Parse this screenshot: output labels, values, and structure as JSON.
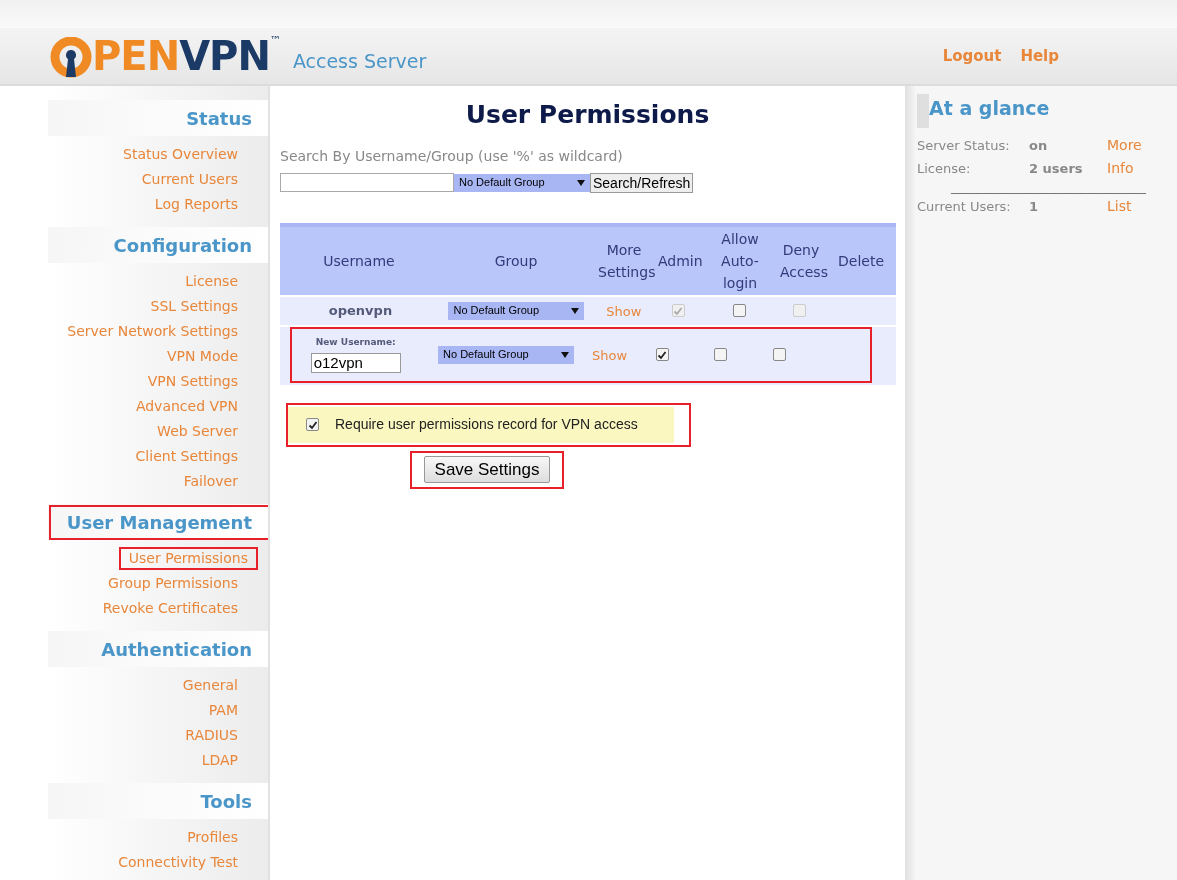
{
  "header": {
    "logo": {
      "prefix": "PEN",
      "suffix": "VPN",
      "mark": "™"
    },
    "subtitle": "Access Server",
    "links": [
      "Logout",
      "Help"
    ]
  },
  "sidebar": [
    {
      "title": "Status",
      "highlighted": false,
      "items": [
        {
          "label": "Status Overview",
          "highlighted": false
        },
        {
          "label": "Current Users",
          "highlighted": false
        },
        {
          "label": "Log Reports",
          "highlighted": false
        }
      ]
    },
    {
      "title": "Configuration",
      "highlighted": false,
      "items": [
        {
          "label": "License",
          "highlighted": false
        },
        {
          "label": "SSL Settings",
          "highlighted": false
        },
        {
          "label": "Server Network Settings",
          "highlighted": false
        },
        {
          "label": "VPN Mode",
          "highlighted": false
        },
        {
          "label": "VPN Settings",
          "highlighted": false
        },
        {
          "label": "Advanced VPN",
          "highlighted": false
        },
        {
          "label": "Web Server",
          "highlighted": false
        },
        {
          "label": "Client Settings",
          "highlighted": false
        },
        {
          "label": "Failover",
          "highlighted": false
        }
      ]
    },
    {
      "title": "User Management",
      "highlighted": true,
      "items": [
        {
          "label": "User Permissions",
          "highlighted": true
        },
        {
          "label": "Group Permissions",
          "highlighted": false
        },
        {
          "label": "Revoke Certificates",
          "highlighted": false
        }
      ]
    },
    {
      "title": "Authentication",
      "highlighted": false,
      "items": [
        {
          "label": "General",
          "highlighted": false
        },
        {
          "label": "PAM",
          "highlighted": false
        },
        {
          "label": "RADIUS",
          "highlighted": false
        },
        {
          "label": "LDAP",
          "highlighted": false
        }
      ]
    },
    {
      "title": "Tools",
      "highlighted": false,
      "items": [
        {
          "label": "Profiles",
          "highlighted": false
        },
        {
          "label": "Connectivity Test",
          "highlighted": false
        }
      ]
    }
  ],
  "main": {
    "title": "User Permissions",
    "search": {
      "label": "Search By Username/Group (use '%' as wildcard)",
      "group": "No Default Group",
      "button": "Search/Refresh"
    },
    "table": {
      "columns": [
        "Username",
        "Group",
        "More Settings",
        "Admin",
        "Allow Auto-login",
        "Deny Access",
        "Delete"
      ],
      "rows": [
        {
          "kind": "existing",
          "username": "openvpn",
          "group": "No Default Group",
          "more": "Show",
          "admin": {
            "checked": true,
            "disabled": true
          },
          "autologin": {
            "checked": false,
            "disabled": false
          },
          "deny": {
            "checked": false,
            "disabled": true
          },
          "highlighted": false
        },
        {
          "kind": "new",
          "label": "New Username:",
          "value": "o12vpn",
          "group": "No Default Group",
          "more": "Show",
          "admin": {
            "checked": true,
            "disabled": false
          },
          "autologin": {
            "checked": false,
            "disabled": false
          },
          "deny": {
            "checked": false,
            "disabled": false
          },
          "highlighted": true
        }
      ]
    },
    "require": {
      "label": "Require user permissions record for VPN access",
      "checked": true,
      "highlighted": true
    },
    "save": {
      "label": "Save Settings",
      "highlighted": true
    }
  },
  "glance": {
    "title": "At a glance",
    "rows": [
      {
        "label": "Server Status:",
        "value": "on",
        "link": "More"
      },
      {
        "label": "License:",
        "value": "2 users",
        "link": "Info"
      }
    ],
    "divider": "______________________________",
    "current": {
      "label": "Current Users:",
      "value": "1",
      "link": "List"
    }
  }
}
